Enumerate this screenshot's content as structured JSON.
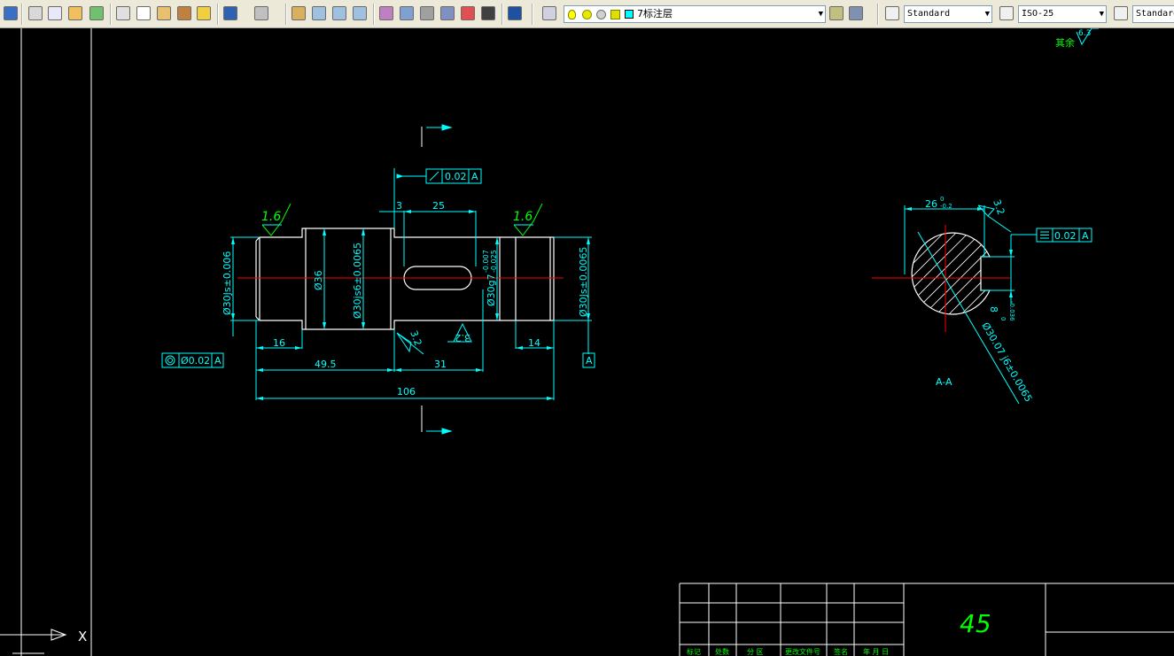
{
  "toolbar": {
    "layer_name": "7标注层",
    "text_style": "Standard",
    "dim_style": "ISO-25",
    "table_style": "Standard",
    "icons": [
      "save-icon",
      "print-icon",
      "print-preview-icon",
      "publish-icon",
      "3d-dwf-icon",
      "cut-icon",
      "copy-icon",
      "paste-icon",
      "match-properties-icon",
      "block-editor-icon",
      "undo-icon",
      "redo-icon",
      "pan-icon",
      "zoom-realtime-icon",
      "zoom-window-icon",
      "zoom-previous-icon",
      "properties-icon",
      "design-center-icon",
      "tool-palettes-icon",
      "sheet-set-icon",
      "markup-icon",
      "calculator-icon",
      "help-icon",
      "layer-manager-icon",
      "layer-state-icon",
      "layer-previous-icon",
      "make-current-icon",
      "text-style-icon",
      "dim-style-icon",
      "table-style-icon"
    ],
    "colors": {
      "bg": "#ece9d8",
      "bulb": "#ffff00",
      "sun": "#e8e800",
      "layer_swatch": "#00ffff"
    }
  },
  "drawing": {
    "colors": {
      "geometry": "#ffffff",
      "dim": "#00ffff",
      "center": "#ff0000",
      "roughness": "#00ff00",
      "hatch": "#ffffff",
      "text": "#00ffff"
    },
    "roughness_note": {
      "prefix": "其余",
      "value": "6.3"
    },
    "front_view": {
      "roughness_left": "1.6",
      "roughness_right": "1.6",
      "roughness_key1": "3.2",
      "roughness_key2": "3.2",
      "runout_value": "0.02",
      "datum": "A",
      "coax_value": "Ø0.02",
      "dim_3": "3",
      "dim_25": "25",
      "dim_16": "16",
      "dim_49_5": "49.5",
      "dim_31": "31",
      "dim_14": "14",
      "dim_106": "106",
      "dia_left": "Ø30Js±0.006",
      "dia_36": "Ø36",
      "dia_js6": "Ø30js6±0.0065",
      "dia_g7": "Ø30g7",
      "dia_g7_upper": "-0.007",
      "dia_g7_lower": "-0.025",
      "dia_right": "Ø30Js±0.0065"
    },
    "section_view": {
      "label": "A-A",
      "dim_26": "26",
      "dim_26_upper": "0",
      "dim_26_lower": "-0.2",
      "roughness": "3.2",
      "sym_value": "0.02",
      "datum": "A",
      "dim_8": "8",
      "dim_8_upper": "0",
      "dim_8_lower": "-0.036",
      "dia_note": "Ø30.07 j6±0.0065"
    },
    "title_block": {
      "material": "45",
      "headers": [
        "标记",
        "处数",
        "分 区",
        "更改文件号",
        "签名",
        "年 月 日"
      ]
    },
    "ucs": {
      "x_label": "X"
    }
  }
}
